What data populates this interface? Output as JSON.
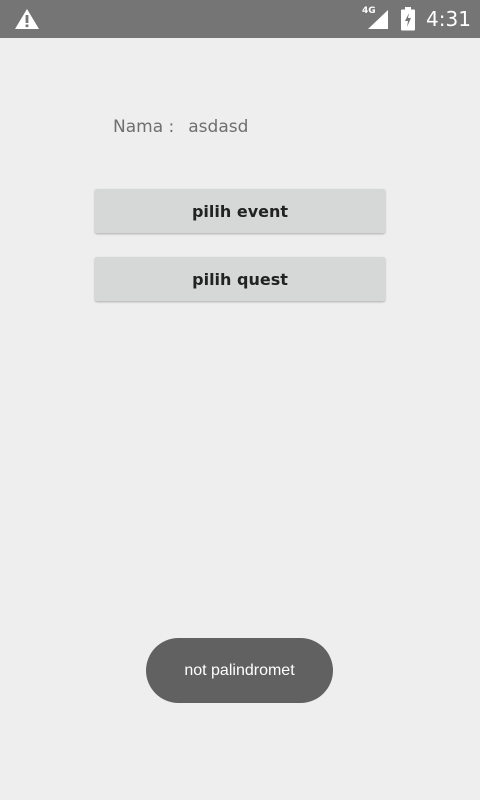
{
  "status_bar": {
    "network_type": "4G",
    "time": "4:31",
    "icons": [
      "warning-icon",
      "signal-icon",
      "battery-charging-icon"
    ]
  },
  "form": {
    "name_label": "Nama :",
    "name_value": "asdasd"
  },
  "buttons": {
    "event_label": "pilih event",
    "quest_label": "pilih quest"
  },
  "toast": {
    "message": "not palindromet"
  },
  "colors": {
    "status_bar": "#757575",
    "background": "#eeeeee",
    "button": "#d6d7d7",
    "toast": "#616161"
  }
}
